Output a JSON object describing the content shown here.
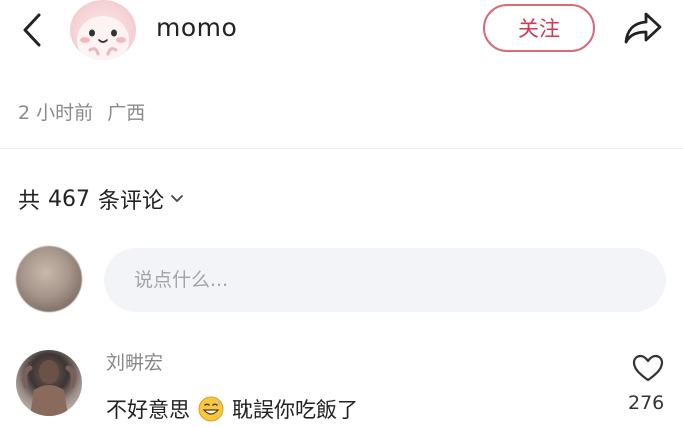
{
  "header": {
    "back_icon": "chevron-left-icon",
    "author_name": "momo",
    "follow_label": "关注",
    "share_icon": "share-icon",
    "accent_color": "#d23a50"
  },
  "post": {
    "time_ago": "2 小时前",
    "location": "广西"
  },
  "comments": {
    "prefix": "共",
    "count": "467",
    "suffix": "条评论",
    "input_placeholder": "说点什么...",
    "items": [
      {
        "author": "刘畊宏",
        "text_before": "不好意思",
        "emoji": "grinning-sweat-emoji",
        "text_after": "耽誤你吃飯了",
        "like_icon": "heart-icon",
        "like_count": "276"
      }
    ]
  }
}
